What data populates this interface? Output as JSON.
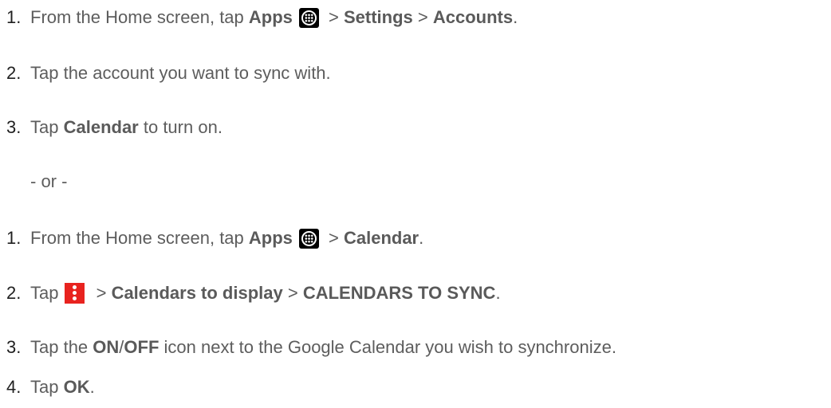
{
  "icons": {
    "apps_icon": "apps-grid-icon",
    "overflow_icon": "more-vertical-icon"
  },
  "colors": {
    "text": "#5d5d5d",
    "menu_icon_bg": "#e8231f",
    "apps_icon_bg": "#000000"
  },
  "section1": {
    "steps": [
      {
        "num": "1.",
        "t1": "From the Home screen, tap ",
        "b1": "Apps",
        "t2": " > ",
        "b2": "Settings",
        "t3": " > ",
        "b3": "Accounts",
        "t4": "."
      },
      {
        "num": "2.",
        "t1": "Tap the account you want to sync with."
      },
      {
        "num": "3.",
        "t1": "Tap ",
        "b1": "Calendar",
        "t2": " to turn on."
      }
    ]
  },
  "separator": "- or -",
  "section2": {
    "steps": [
      {
        "num": "1.",
        "t1": "From the Home screen, tap ",
        "b1": "Apps",
        "t2": " > ",
        "b2": "Calendar",
        "t3": "."
      },
      {
        "num": "2.",
        "t1": "Tap",
        "t2": " > ",
        "b1": "Calendars to display",
        "t3": " > ",
        "b2": "CALENDARS TO SYNC",
        "t4": "."
      },
      {
        "num": "3.",
        "t1": "Tap the ",
        "b1": "ON",
        "t2": "/",
        "b2": "OFF",
        "t3": " icon next to the Google Calendar you wish to synchronize."
      },
      {
        "num": "4.",
        "t1": "Tap ",
        "b1": "OK",
        "t2": "."
      }
    ]
  }
}
